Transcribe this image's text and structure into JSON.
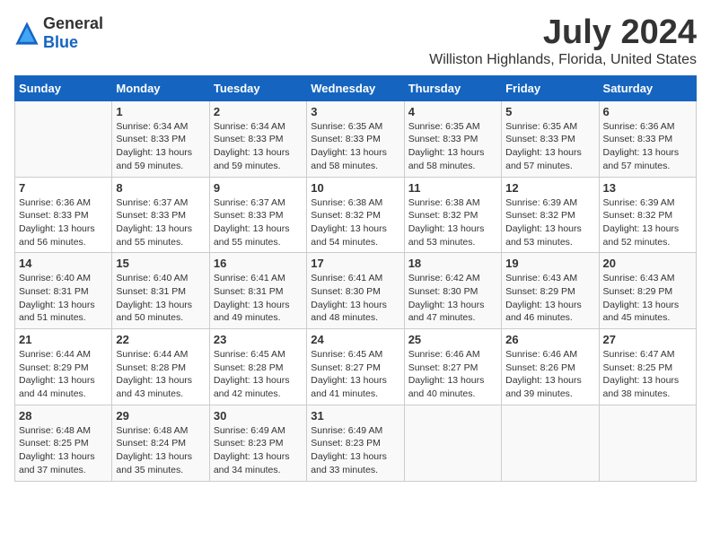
{
  "logo": {
    "general": "General",
    "blue": "Blue"
  },
  "title": "July 2024",
  "subtitle": "Williston Highlands, Florida, United States",
  "days_of_week": [
    "Sunday",
    "Monday",
    "Tuesday",
    "Wednesday",
    "Thursday",
    "Friday",
    "Saturday"
  ],
  "weeks": [
    [
      {
        "day": "",
        "sunrise": "",
        "sunset": "",
        "daylight": ""
      },
      {
        "day": "1",
        "sunrise": "Sunrise: 6:34 AM",
        "sunset": "Sunset: 8:33 PM",
        "daylight": "Daylight: 13 hours and 59 minutes."
      },
      {
        "day": "2",
        "sunrise": "Sunrise: 6:34 AM",
        "sunset": "Sunset: 8:33 PM",
        "daylight": "Daylight: 13 hours and 59 minutes."
      },
      {
        "day": "3",
        "sunrise": "Sunrise: 6:35 AM",
        "sunset": "Sunset: 8:33 PM",
        "daylight": "Daylight: 13 hours and 58 minutes."
      },
      {
        "day": "4",
        "sunrise": "Sunrise: 6:35 AM",
        "sunset": "Sunset: 8:33 PM",
        "daylight": "Daylight: 13 hours and 58 minutes."
      },
      {
        "day": "5",
        "sunrise": "Sunrise: 6:35 AM",
        "sunset": "Sunset: 8:33 PM",
        "daylight": "Daylight: 13 hours and 57 minutes."
      },
      {
        "day": "6",
        "sunrise": "Sunrise: 6:36 AM",
        "sunset": "Sunset: 8:33 PM",
        "daylight": "Daylight: 13 hours and 57 minutes."
      }
    ],
    [
      {
        "day": "7",
        "sunrise": "Sunrise: 6:36 AM",
        "sunset": "Sunset: 8:33 PM",
        "daylight": "Daylight: 13 hours and 56 minutes."
      },
      {
        "day": "8",
        "sunrise": "Sunrise: 6:37 AM",
        "sunset": "Sunset: 8:33 PM",
        "daylight": "Daylight: 13 hours and 55 minutes."
      },
      {
        "day": "9",
        "sunrise": "Sunrise: 6:37 AM",
        "sunset": "Sunset: 8:33 PM",
        "daylight": "Daylight: 13 hours and 55 minutes."
      },
      {
        "day": "10",
        "sunrise": "Sunrise: 6:38 AM",
        "sunset": "Sunset: 8:32 PM",
        "daylight": "Daylight: 13 hours and 54 minutes."
      },
      {
        "day": "11",
        "sunrise": "Sunrise: 6:38 AM",
        "sunset": "Sunset: 8:32 PM",
        "daylight": "Daylight: 13 hours and 53 minutes."
      },
      {
        "day": "12",
        "sunrise": "Sunrise: 6:39 AM",
        "sunset": "Sunset: 8:32 PM",
        "daylight": "Daylight: 13 hours and 53 minutes."
      },
      {
        "day": "13",
        "sunrise": "Sunrise: 6:39 AM",
        "sunset": "Sunset: 8:32 PM",
        "daylight": "Daylight: 13 hours and 52 minutes."
      }
    ],
    [
      {
        "day": "14",
        "sunrise": "Sunrise: 6:40 AM",
        "sunset": "Sunset: 8:31 PM",
        "daylight": "Daylight: 13 hours and 51 minutes."
      },
      {
        "day": "15",
        "sunrise": "Sunrise: 6:40 AM",
        "sunset": "Sunset: 8:31 PM",
        "daylight": "Daylight: 13 hours and 50 minutes."
      },
      {
        "day": "16",
        "sunrise": "Sunrise: 6:41 AM",
        "sunset": "Sunset: 8:31 PM",
        "daylight": "Daylight: 13 hours and 49 minutes."
      },
      {
        "day": "17",
        "sunrise": "Sunrise: 6:41 AM",
        "sunset": "Sunset: 8:30 PM",
        "daylight": "Daylight: 13 hours and 48 minutes."
      },
      {
        "day": "18",
        "sunrise": "Sunrise: 6:42 AM",
        "sunset": "Sunset: 8:30 PM",
        "daylight": "Daylight: 13 hours and 47 minutes."
      },
      {
        "day": "19",
        "sunrise": "Sunrise: 6:43 AM",
        "sunset": "Sunset: 8:29 PM",
        "daylight": "Daylight: 13 hours and 46 minutes."
      },
      {
        "day": "20",
        "sunrise": "Sunrise: 6:43 AM",
        "sunset": "Sunset: 8:29 PM",
        "daylight": "Daylight: 13 hours and 45 minutes."
      }
    ],
    [
      {
        "day": "21",
        "sunrise": "Sunrise: 6:44 AM",
        "sunset": "Sunset: 8:29 PM",
        "daylight": "Daylight: 13 hours and 44 minutes."
      },
      {
        "day": "22",
        "sunrise": "Sunrise: 6:44 AM",
        "sunset": "Sunset: 8:28 PM",
        "daylight": "Daylight: 13 hours and 43 minutes."
      },
      {
        "day": "23",
        "sunrise": "Sunrise: 6:45 AM",
        "sunset": "Sunset: 8:28 PM",
        "daylight": "Daylight: 13 hours and 42 minutes."
      },
      {
        "day": "24",
        "sunrise": "Sunrise: 6:45 AM",
        "sunset": "Sunset: 8:27 PM",
        "daylight": "Daylight: 13 hours and 41 minutes."
      },
      {
        "day": "25",
        "sunrise": "Sunrise: 6:46 AM",
        "sunset": "Sunset: 8:27 PM",
        "daylight": "Daylight: 13 hours and 40 minutes."
      },
      {
        "day": "26",
        "sunrise": "Sunrise: 6:46 AM",
        "sunset": "Sunset: 8:26 PM",
        "daylight": "Daylight: 13 hours and 39 minutes."
      },
      {
        "day": "27",
        "sunrise": "Sunrise: 6:47 AM",
        "sunset": "Sunset: 8:25 PM",
        "daylight": "Daylight: 13 hours and 38 minutes."
      }
    ],
    [
      {
        "day": "28",
        "sunrise": "Sunrise: 6:48 AM",
        "sunset": "Sunset: 8:25 PM",
        "daylight": "Daylight: 13 hours and 37 minutes."
      },
      {
        "day": "29",
        "sunrise": "Sunrise: 6:48 AM",
        "sunset": "Sunset: 8:24 PM",
        "daylight": "Daylight: 13 hours and 35 minutes."
      },
      {
        "day": "30",
        "sunrise": "Sunrise: 6:49 AM",
        "sunset": "Sunset: 8:23 PM",
        "daylight": "Daylight: 13 hours and 34 minutes."
      },
      {
        "day": "31",
        "sunrise": "Sunrise: 6:49 AM",
        "sunset": "Sunset: 8:23 PM",
        "daylight": "Daylight: 13 hours and 33 minutes."
      },
      {
        "day": "",
        "sunrise": "",
        "sunset": "",
        "daylight": ""
      },
      {
        "day": "",
        "sunrise": "",
        "sunset": "",
        "daylight": ""
      },
      {
        "day": "",
        "sunrise": "",
        "sunset": "",
        "daylight": ""
      }
    ]
  ]
}
